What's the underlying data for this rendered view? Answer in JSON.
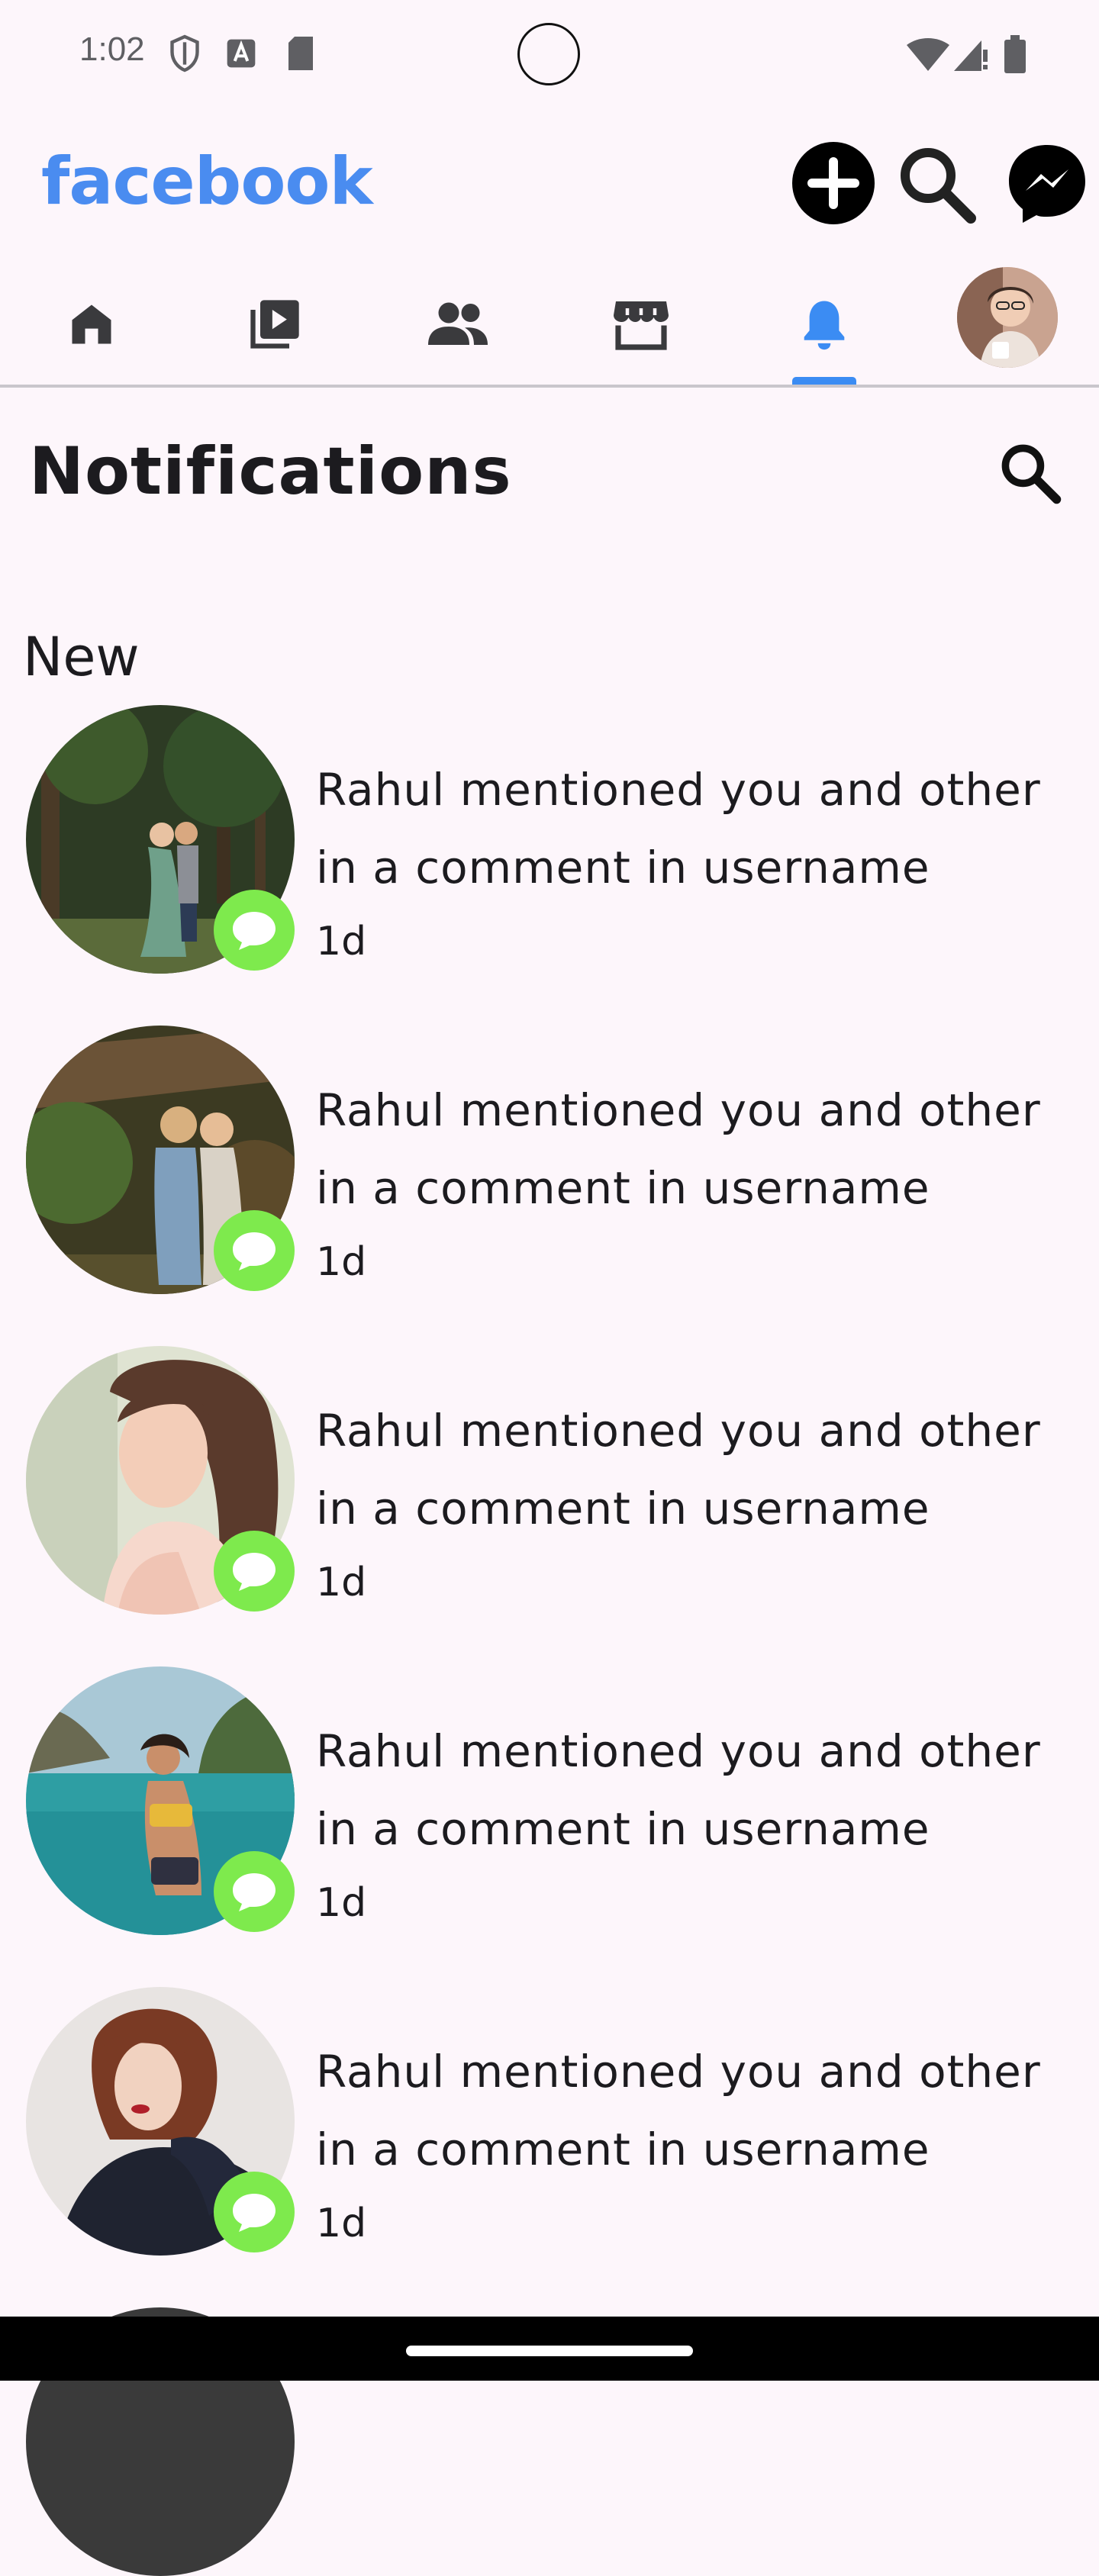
{
  "status_bar": {
    "time": "1:02",
    "icons": [
      "shield-icon",
      "a-box-icon",
      "sd-card-icon",
      "wifi-icon",
      "signal-icon",
      "battery-icon"
    ]
  },
  "app_bar": {
    "logo": "facebook",
    "logo_color": "#4a8cf0",
    "actions": [
      "plus-icon",
      "search-icon",
      "messenger-icon"
    ]
  },
  "tabs": {
    "items": [
      "home-icon",
      "video-icon",
      "friends-icon",
      "marketplace-icon",
      "bell-icon",
      "profile-avatar"
    ],
    "active": "bell-icon",
    "active_color": "#3b8cf3"
  },
  "page": {
    "title": "Notifications",
    "section": "New"
  },
  "notifications": [
    {
      "line1": "Rahul mentioned you and other",
      "line2": "in a comment in username",
      "time": "1d"
    },
    {
      "line1": "Rahul mentioned you and other",
      "line2": "in a comment in username",
      "time": "1d"
    },
    {
      "line1": "Rahul mentioned you and other",
      "line2": "in a comment in username",
      "time": "1d"
    },
    {
      "line1": "Rahul mentioned you and other",
      "line2": "in a comment in username",
      "time": "1d"
    },
    {
      "line1": "Rahul mentioned you and other",
      "line2": "in a comment in username",
      "time": "1d"
    }
  ],
  "badge_color": "#7eea4d"
}
